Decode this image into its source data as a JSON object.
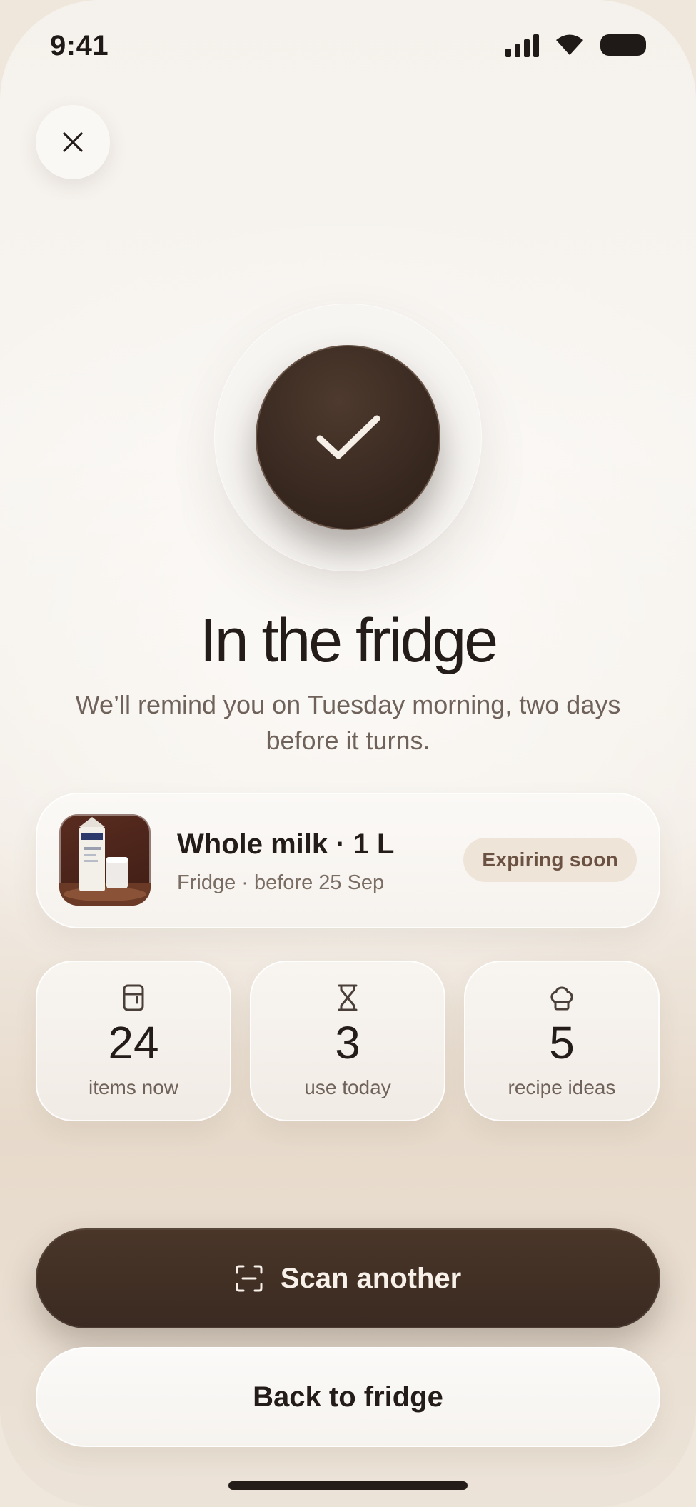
{
  "status_bar": {
    "time": "9:41",
    "icons": [
      "signal-icon",
      "wifi-icon",
      "battery-icon"
    ]
  },
  "header": {
    "close_icon": "close-icon"
  },
  "hero": {
    "icon": "checkmark-icon",
    "title": "In the fridge",
    "subtitle": "We’ll remind you on Tuesday morning, two days before it turns."
  },
  "product": {
    "name": "Whole milk · 1 L",
    "meta": "Fridge · before 25 Sep",
    "badge": "Expiring soon",
    "image": "milk-carton-image"
  },
  "stats": [
    {
      "icon": "fridge-icon",
      "value": "24",
      "label": "items now"
    },
    {
      "icon": "hourglass-icon",
      "value": "3",
      "label": "use today"
    },
    {
      "icon": "chef-hat-icon",
      "value": "5",
      "label": "recipe ideas"
    }
  ],
  "actions": {
    "primary_label": "Scan another",
    "primary_icon": "scan-icon",
    "secondary_label": "Back to fridge"
  },
  "colors": {
    "accent_dark": "#3a2a21",
    "badge_bg": "#efe4d8",
    "badge_text": "#6b5142",
    "text_primary": "#231c18",
    "text_secondary": "#6f625a"
  }
}
